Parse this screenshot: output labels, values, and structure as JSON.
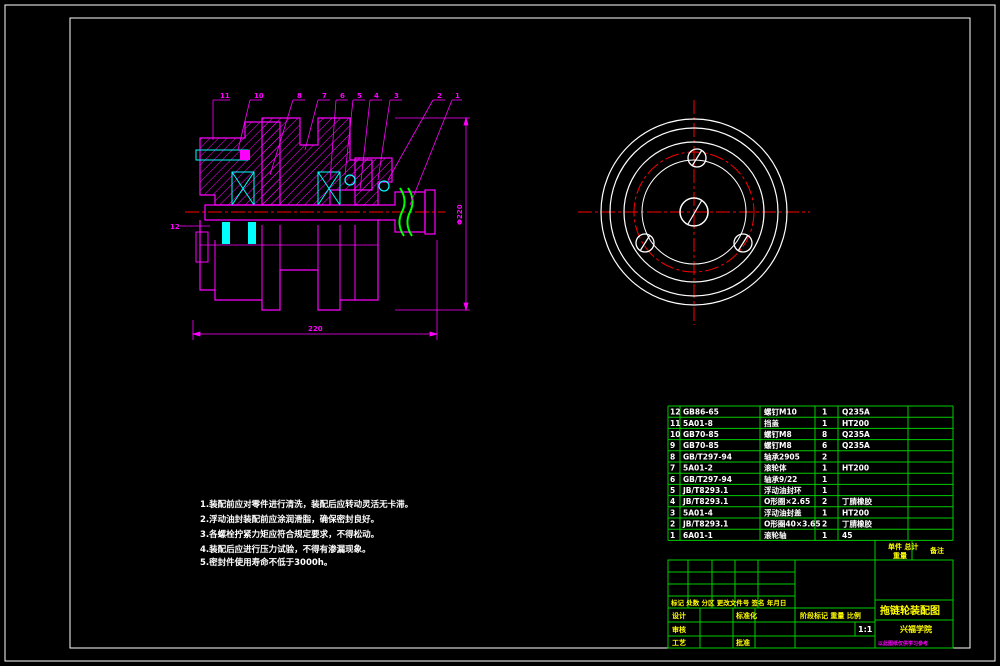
{
  "colors": {
    "background": "#000000",
    "frame": "#ffffff",
    "part": "#ff00ff",
    "hatch": "#ff00ff",
    "center_line": "#ff0000",
    "dimension": "#ff00ff",
    "table_line": "#00cc00",
    "table_text": "#ffff00",
    "white_text": "#ffffff",
    "key_part": "#00ffff"
  },
  "section_view": {
    "leader_labels": [
      "11",
      "10",
      "8",
      "7",
      "6",
      "5",
      "4",
      "3",
      "2",
      "1"
    ],
    "side_label": "12",
    "dim_width": "220",
    "dim_height": "Φ220"
  },
  "notes": {
    "lines": [
      "1.装配前应对零件进行清洗，装配后应转动灵活无卡滞。",
      "2.浮动油封装配前应涂润滑脂，确保密封良好。",
      "3.各螺栓拧紧力矩应符合规定要求，不得松动。",
      "4.装配后应进行压力试验，不得有渗漏现象。",
      "5.密封件使用寿命不低于3000h。"
    ]
  },
  "parts_table": {
    "rows": [
      {
        "no": "12",
        "code": "GB86-65",
        "name": "螺钉M10",
        "qty": "1",
        "material": "Q235A"
      },
      {
        "no": "11",
        "code": "5A01-8",
        "name": "挡盖",
        "qty": "1",
        "material": "HT200"
      },
      {
        "no": "10",
        "code": "GB70-85",
        "name": "螺钉M8",
        "qty": "8",
        "material": "Q235A"
      },
      {
        "no": "9",
        "code": "GB70-85",
        "name": "螺钉M8",
        "qty": "6",
        "material": "Q235A"
      },
      {
        "no": "8",
        "code": "GB/T297-94",
        "name": "轴承2905",
        "qty": "2",
        "material": ""
      },
      {
        "no": "7",
        "code": "5A01-2",
        "name": "滚轮体",
        "qty": "1",
        "material": "HT200"
      },
      {
        "no": "6",
        "code": "GB/T297-94",
        "name": "轴承9/22",
        "qty": "1",
        "material": ""
      },
      {
        "no": "5",
        "code": "JB/T8293.1",
        "name": "浮动油封环",
        "qty": "1",
        "material": ""
      },
      {
        "no": "4",
        "code": "JB/T8293.1",
        "name": "O形圈×2.65",
        "qty": "2",
        "material": "丁腈橡胶"
      },
      {
        "no": "3",
        "code": "5A01-4",
        "name": "浮动油封盖",
        "qty": "1",
        "material": "HT200"
      },
      {
        "no": "2",
        "code": "JB/T8293.1",
        "name": "O形圈40×3.65",
        "qty": "2",
        "material": "丁腈橡胶"
      },
      {
        "no": "1",
        "code": "6A01-1",
        "name": "滚轮轴",
        "qty": "1",
        "material": "45"
      }
    ],
    "right_header": {
      "unit_weight": "单件 总计",
      "weight": "重量",
      "remark": "备注"
    }
  },
  "title_block": {
    "title": "拖链轮装配图",
    "school": "兴福学院",
    "scale": "1:1",
    "mark_labels": "阶段标记  重量  比例",
    "row_biaoji": "标记  处数  分区  更改文件号  签名  年月日",
    "row_design": "设计",
    "row_standard": "标准化",
    "row_review": "审核",
    "row_craft": "工艺",
    "row_approve": "批准",
    "footer": "以此图纸仅供学习参考"
  }
}
